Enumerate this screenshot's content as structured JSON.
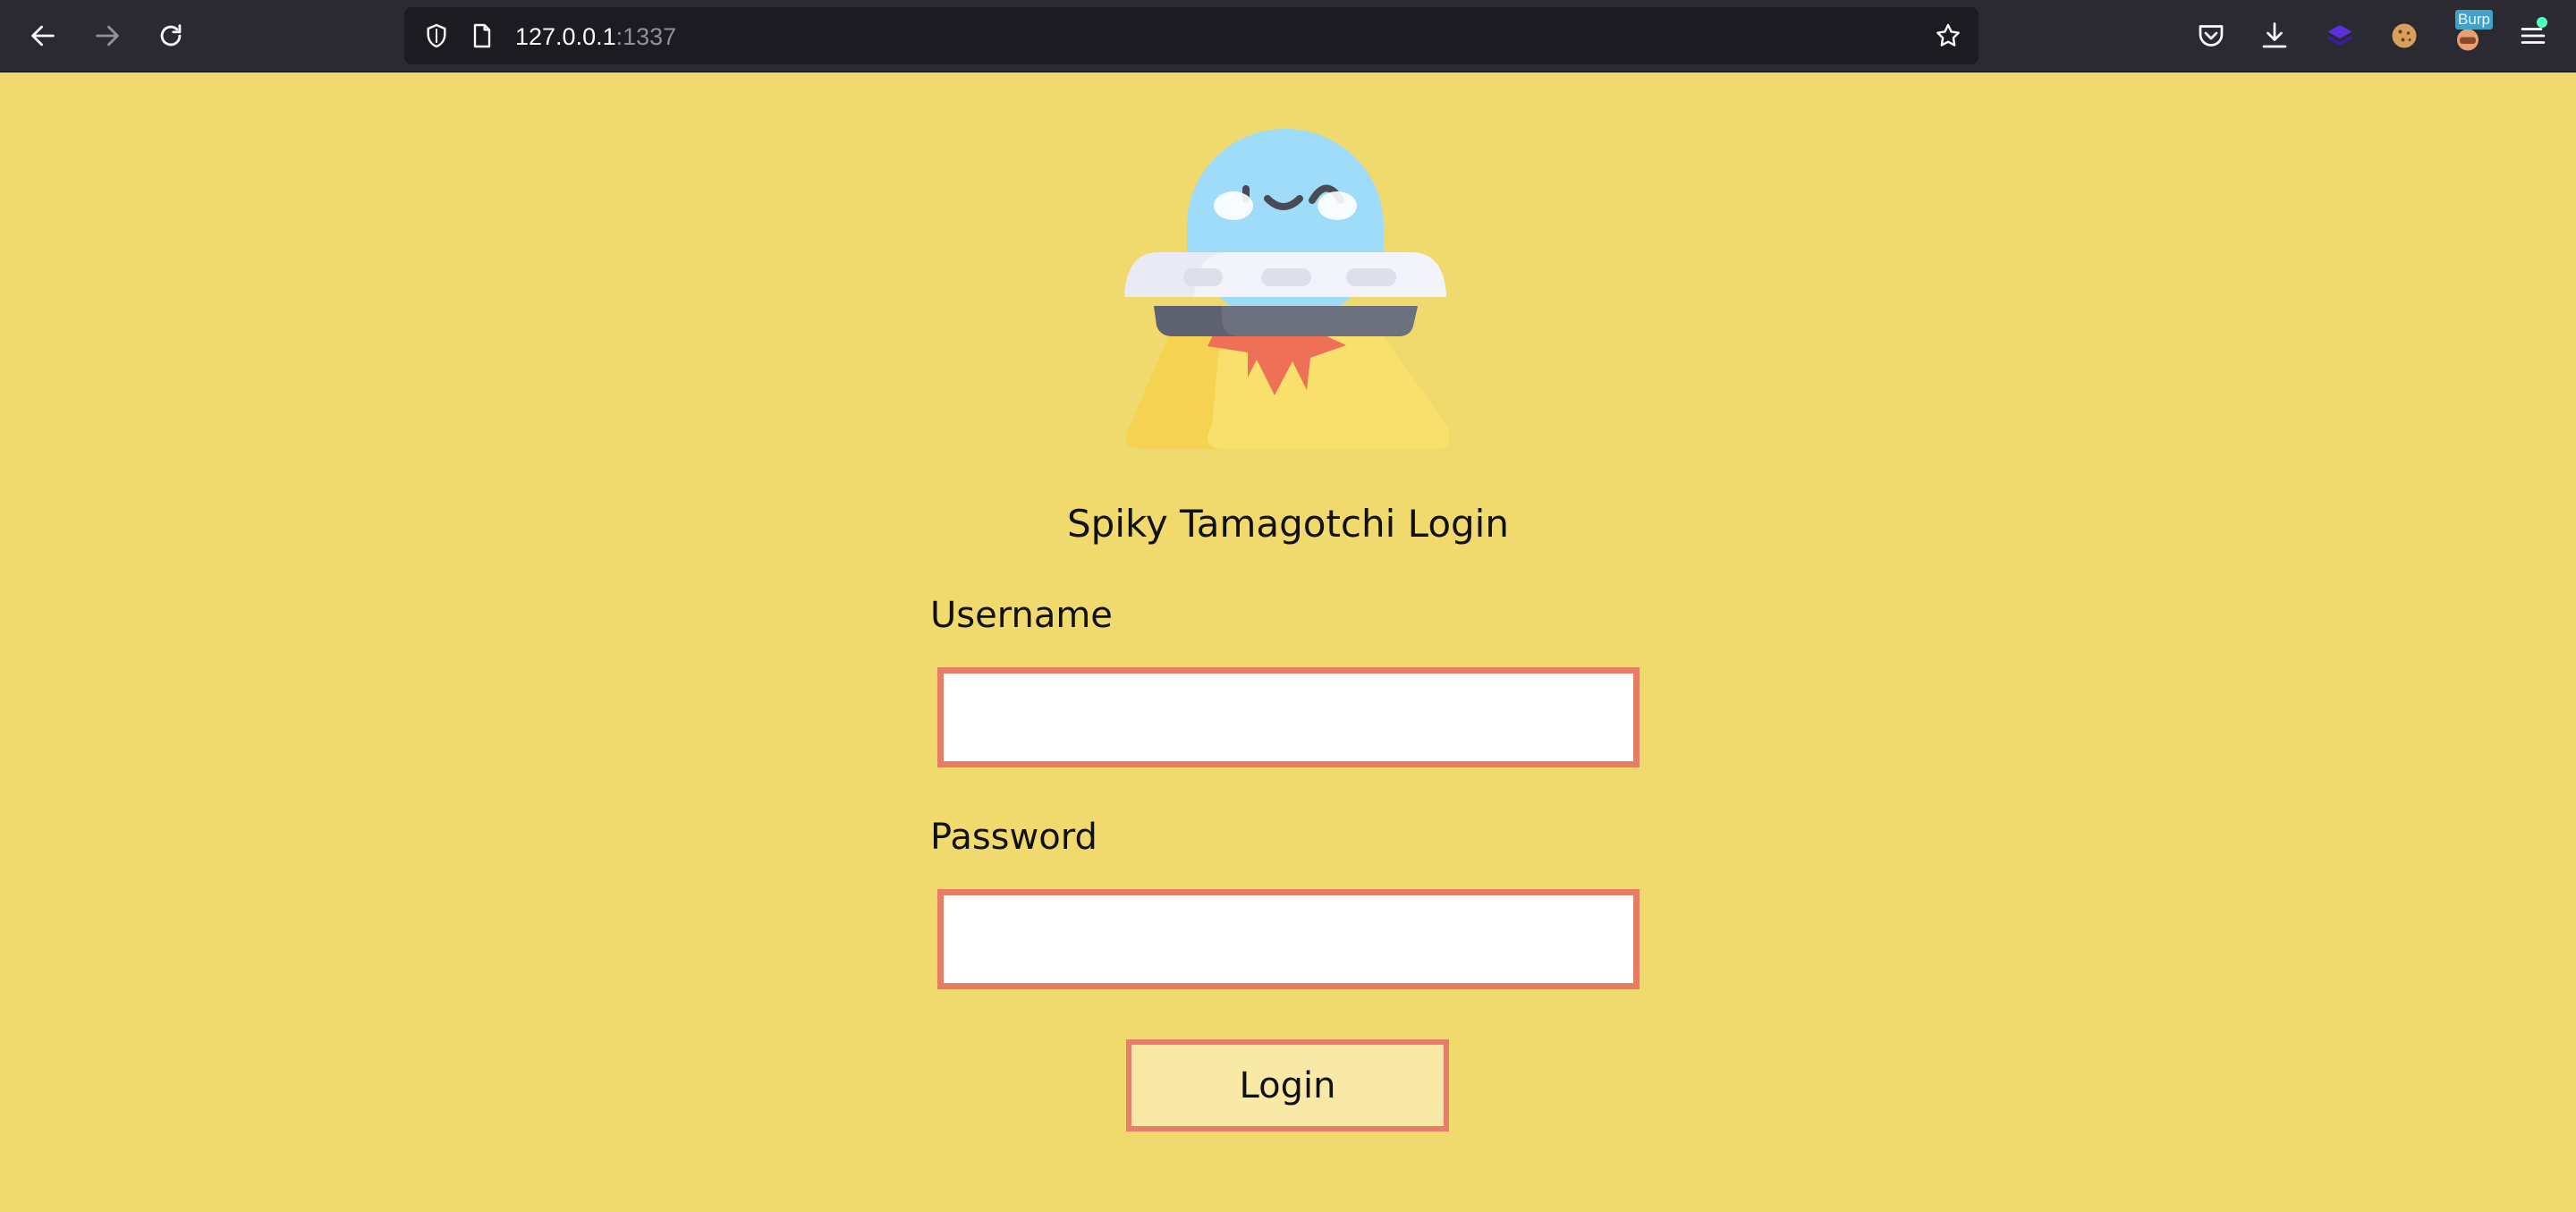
{
  "browser": {
    "url_host": "127.0.0.1",
    "url_port": ":1337",
    "burp_badge": "Burp",
    "colors": {
      "toolbar": "#2b2a33",
      "urlbar": "#1c1b22",
      "icon": "#fbfbfe",
      "disabled_icon": "#8f8f9d",
      "notification_dot": "#54ffbd"
    },
    "toolbar_icons": [
      "back-arrow-icon",
      "forward-arrow-icon",
      "reload-icon",
      "tracking-shield-icon",
      "page-icon",
      "bookmark-star-icon",
      "pocket-icon",
      "download-icon",
      "extension-stack-icon",
      "cookie-icon",
      "burp-extension-icon",
      "hamburger-menu-icon"
    ]
  },
  "page": {
    "background": "#f0da6d",
    "mascot": "ufo-mascot",
    "title": "Spiky Tamagotchi Login",
    "username_label": "Username",
    "username_value": "",
    "password_label": "Password",
    "password_value": "",
    "login_label": "Login",
    "accent": "#e87d65",
    "button_fill": "#f8e9a6"
  }
}
